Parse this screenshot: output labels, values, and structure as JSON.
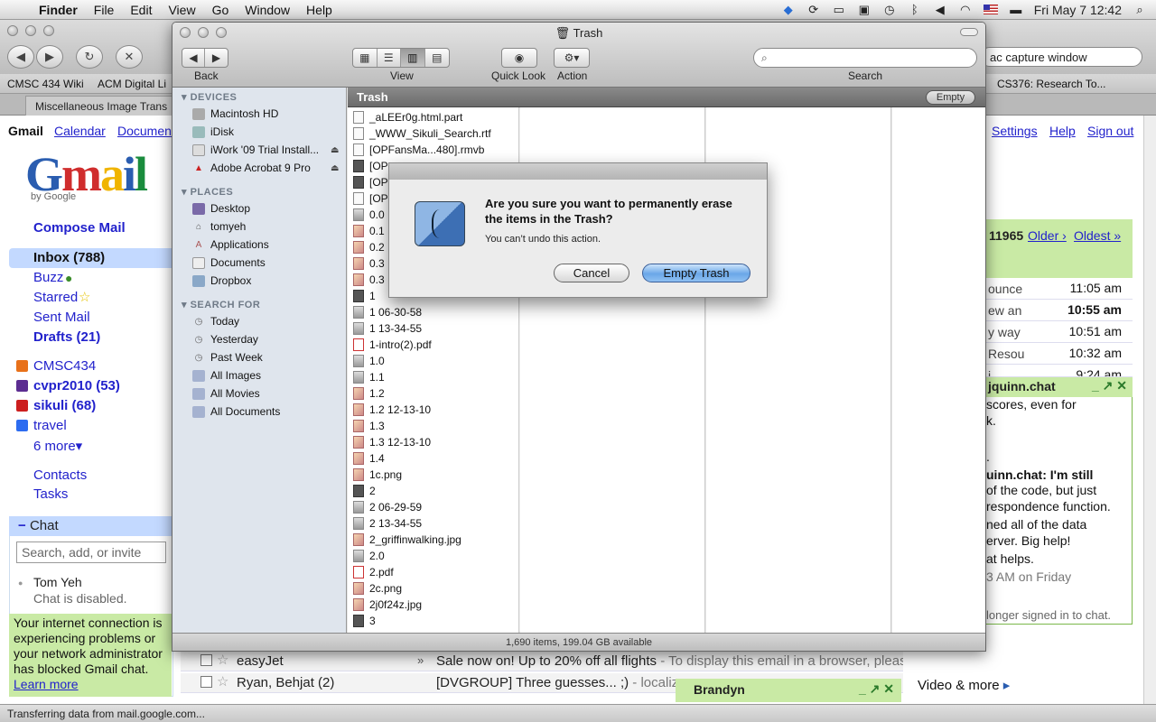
{
  "menubar": {
    "app": "Finder",
    "items": [
      "File",
      "Edit",
      "View",
      "Go",
      "Window",
      "Help"
    ],
    "clock": "Fri May 7  12:42"
  },
  "browser": {
    "search_value": "ac capture window",
    "bookmarks": [
      "CMSC 434 Wiki",
      "ACM Digital Li",
      "CS376: Research To..."
    ],
    "tab_label": "Miscellaneous Image Trans"
  },
  "gmail": {
    "top_links": {
      "gmail": "Gmail",
      "calendar": "Calendar",
      "documents": "Documen",
      "settings": "Settings",
      "help": "Help",
      "signout": "Sign out"
    },
    "logo": {
      "g": "G",
      "m": "m",
      "a": "a",
      "i": "i",
      "l": "l",
      "by": "by Google"
    },
    "compose": "Compose Mail",
    "nav": {
      "inbox": "Inbox (788)",
      "buzz": "Buzz",
      "starred": "Starred",
      "sent": "Sent Mail",
      "drafts": "Drafts (21)"
    },
    "labels": [
      {
        "name": "CMSC434",
        "color": "#e8711a"
      },
      {
        "name": "cvpr2010 (53)",
        "color": "#5c2d91"
      },
      {
        "name": "sikuli (68)",
        "color": "#cc1f1f"
      },
      {
        "name": "travel",
        "color": "#2d6cf0"
      }
    ],
    "more": "6 more▾",
    "contacts": "Contacts",
    "tasks": "Tasks",
    "chat": {
      "title": "Chat",
      "input_placeholder": "Search, add, or invite",
      "user": "Tom Yeh",
      "status": "Chat is disabled.",
      "warning": "Your internet connection is experiencing problems or your network administrator has blocked Gmail chat.",
      "learn_more": "Learn more"
    },
    "pager": {
      "count": "11965",
      "older": "Older ›",
      "oldest": "Oldest »"
    },
    "mail_rows": [
      {
        "sender": "ounce",
        "time": "11:05 am"
      },
      {
        "sender": "ew an",
        "time": "10:55 am"
      },
      {
        "sender": "y way",
        "time": "10:51 am"
      },
      {
        "sender": "Resou",
        "time": "10:32 am"
      },
      {
        "sender": "i ...",
        "time": "9:24 am"
      }
    ],
    "chat_window": {
      "title": "jquinn.chat",
      "lines": [
        " scores, even for",
        "k.",
        "",
        ".",
        "uinn.chat:  I'm still",
        " of the code, but just",
        "respondence function.",
        "ned all of the data",
        "erver.  Big help!",
        "at helps.",
        "3 AM on Friday"
      ],
      "signed_out": "longer signed in to chat."
    },
    "emails": [
      {
        "sender": "easyJet",
        "subject": "Sale now on! Up to 20% off all flights",
        "snippet": " - To display this email in a browser, please cli"
      },
      {
        "sender": "Ryan, Behjat (2)",
        "subject": "[DVGROUP] Three guesses... ;)",
        "snippet": " - localize"
      }
    ],
    "brandyn": "Brandyn",
    "video_more": "Video & more"
  },
  "statusbar": "Transferring data from mail.google.com...",
  "finder": {
    "title": "Trash",
    "toolbar": {
      "back": "Back",
      "view": "View",
      "quicklook": "Quick Look",
      "action": "Action",
      "search": "Search"
    },
    "sidebar": {
      "devices_head": "DEVICES",
      "devices": [
        "Macintosh HD",
        "iDisk",
        "iWork '09 Trial Install...",
        "Adobe Acrobat 9 Pro"
      ],
      "places_head": "PLACES",
      "places": [
        "Desktop",
        "tomyeh",
        "Applications",
        "Documents",
        "Dropbox"
      ],
      "search_head": "SEARCH FOR",
      "searches": [
        "Today",
        "Yesterday",
        "Past Week",
        "All Images",
        "All Movies",
        "All Documents"
      ]
    },
    "path_title": "Trash",
    "empty_btn": "Empty",
    "files": [
      {
        "name": "_aLEEr0g.html.part",
        "kind": "doc"
      },
      {
        "name": "_WWW_Sikuli_Search.rtf",
        "kind": "doc"
      },
      {
        "name": "[OPFansMa...480].rmvb",
        "kind": "doc"
      },
      {
        "name": "[OP",
        "kind": "dark"
      },
      {
        "name": "[OP",
        "kind": "dark"
      },
      {
        "name": "[OP",
        "kind": "doc"
      },
      {
        "name": "0.0",
        "kind": "mid"
      },
      {
        "name": "0.1",
        "kind": "img"
      },
      {
        "name": "0.2",
        "kind": "img"
      },
      {
        "name": "0.3",
        "kind": "img"
      },
      {
        "name": "0.3",
        "kind": "img"
      },
      {
        "name": "1",
        "kind": "dark"
      },
      {
        "name": "1 06-30-58",
        "kind": "mid"
      },
      {
        "name": "1 13-34-55",
        "kind": "mid"
      },
      {
        "name": "1-intro(2).pdf",
        "kind": "pdf"
      },
      {
        "name": "1.0",
        "kind": "mid"
      },
      {
        "name": "1.1",
        "kind": "mid"
      },
      {
        "name": "1.2",
        "kind": "img"
      },
      {
        "name": "1.2 12-13-10",
        "kind": "img"
      },
      {
        "name": "1.3",
        "kind": "img"
      },
      {
        "name": "1.3 12-13-10",
        "kind": "img"
      },
      {
        "name": "1.4",
        "kind": "img"
      },
      {
        "name": "1c.png",
        "kind": "img"
      },
      {
        "name": "2",
        "kind": "dark"
      },
      {
        "name": "2 06-29-59",
        "kind": "mid"
      },
      {
        "name": "2 13-34-55",
        "kind": "mid"
      },
      {
        "name": "2_griffinwalking.jpg",
        "kind": "img"
      },
      {
        "name": "2.0",
        "kind": "mid"
      },
      {
        "name": "2.pdf",
        "kind": "pdf"
      },
      {
        "name": "2c.png",
        "kind": "img"
      },
      {
        "name": "2j0f24z.jpg",
        "kind": "img"
      },
      {
        "name": "3",
        "kind": "dark"
      }
    ],
    "status": "1,690 items, 199.04 GB available"
  },
  "dialog": {
    "title": "Are you sure you want to permanently erase the items in the Trash?",
    "subtitle": "You can’t undo this action.",
    "cancel": "Cancel",
    "confirm": "Empty Trash"
  }
}
